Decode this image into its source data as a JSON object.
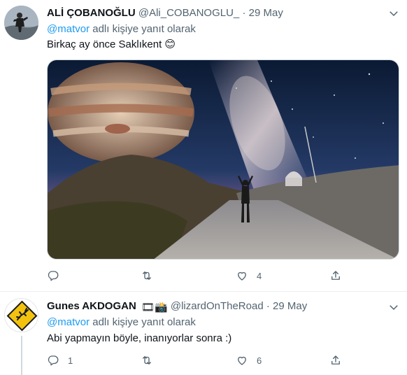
{
  "tweets": [
    {
      "name": "ALİ ÇOBANOĞLU",
      "handle": "@Ali_COBANOGLU_",
      "separator": "·",
      "date": "29 May",
      "reply_prefix": "@matvor",
      "reply_suffix": " adlı kişiye yanıt olarak",
      "text": "Birkaç ay önce Saklıkent 😊",
      "replies": "",
      "retweets": "",
      "likes": "4"
    },
    {
      "name": "Gunes AKDOGAN",
      "badges": "🎞📸",
      "handle": "@lizardOnTheRoad",
      "separator": "·",
      "date": "29 May",
      "reply_prefix": "@matvor",
      "reply_suffix": " adlı kişiye yanıt olarak",
      "text": "Abi yapmayın böyle, inanıyorlar sonra :)",
      "replies": "1",
      "retweets": "",
      "likes": "6"
    }
  ],
  "icons": {
    "reply": "reply-icon",
    "retweet": "retweet-icon",
    "like": "heart-icon",
    "share": "share-icon",
    "more": "chevron-down-icon"
  },
  "colors": {
    "accent": "#1d9bf0",
    "secondary_text": "#536471",
    "divider": "#ebeef0"
  }
}
